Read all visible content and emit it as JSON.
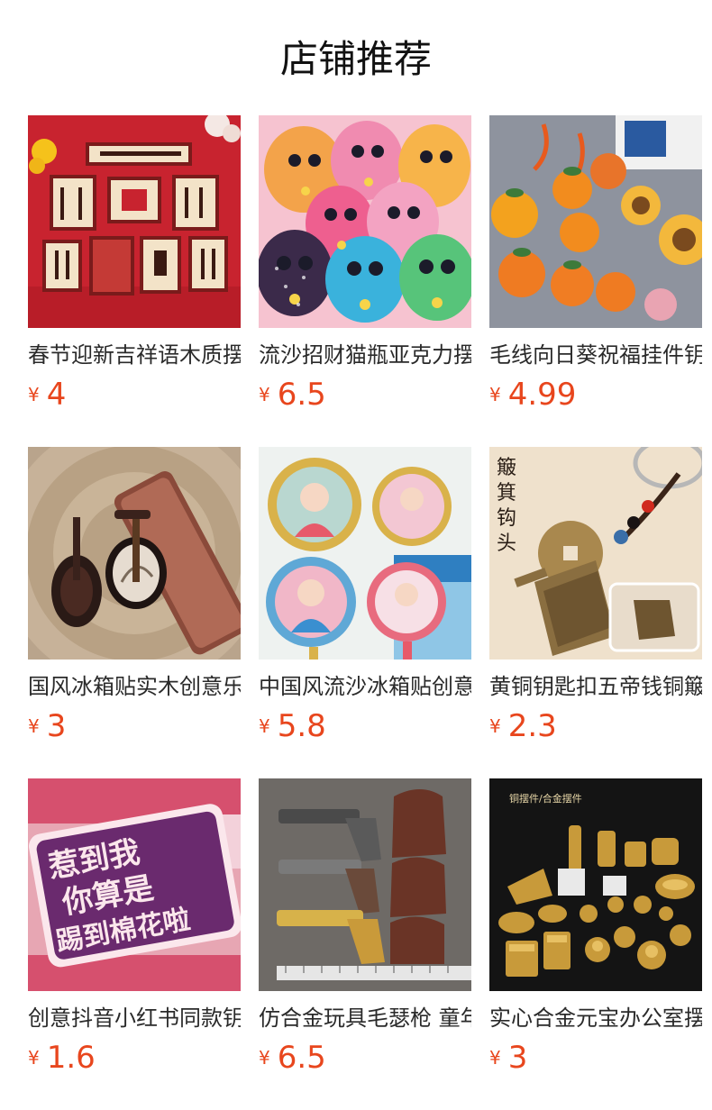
{
  "page": {
    "title": "店铺推荐"
  },
  "currency_symbol": "¥",
  "products": [
    {
      "name": "春节迎新吉祥语木质摆件",
      "price": "4",
      "image": "red-wooden-framed-blessing-plaques"
    },
    {
      "name": "流沙招财猫瓶亚克力摆件",
      "price": "6.5",
      "image": "colorful-glitter-lucky-cats"
    },
    {
      "name": "毛线向日葵祝福挂件钥匙扣",
      "price": "4.99",
      "image": "crochet-sunflower-orange-keychains"
    },
    {
      "name": "国风冰箱贴实木创意乐器",
      "price": "3",
      "image": "miniature-pipa-guzheng-instruments"
    },
    {
      "name": "中国风流沙冰箱贴创意",
      "price": "5.8",
      "image": "chinese-style-girl-fridge-magnets"
    },
    {
      "name": "黄铜钥匙扣五帝钱铜簸箕",
      "price": "2.3",
      "image": "brass-dustpan-coin-keychain"
    },
    {
      "name": "创意抖音小红书同款钥匙扣",
      "price": "1.6",
      "image": "pink-acrylic-text-keychains"
    },
    {
      "name": "仿合金玩具毛瑟枪 童年",
      "price": "6.5",
      "image": "alloy-toy-revolvers-with-holsters"
    },
    {
      "name": "实心合金元宝办公室摆件",
      "price": "3",
      "image": "gold-alloy-miniature-ornaments"
    }
  ],
  "image_text": {
    "p6_brush": [
      "簸",
      "箕",
      "钩",
      "头"
    ],
    "p7_big": [
      "惹到我",
      "你算是",
      "踢到棉花啦"
    ],
    "p9_caption": "铜摆件/合金摆件"
  },
  "colors": {
    "price": "#e8461d",
    "title": "#111111",
    "text": "#2a2a2a",
    "background": "#ffffff"
  }
}
